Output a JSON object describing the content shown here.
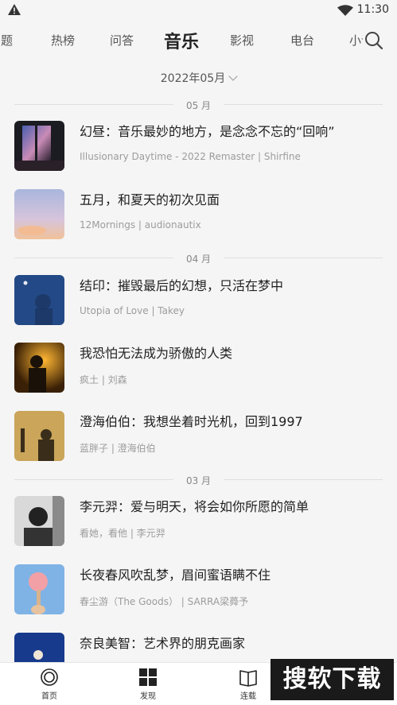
{
  "status_bar": {
    "time": "11:30"
  },
  "tabs": [
    {
      "label": "专题"
    },
    {
      "label": "热榜"
    },
    {
      "label": "问答"
    },
    {
      "label": "音乐"
    },
    {
      "label": "影视"
    },
    {
      "label": "电台"
    },
    {
      "label": "小说"
    }
  ],
  "month_filter": {
    "label": "2022年05月"
  },
  "sections": [
    {
      "month": "05 月",
      "items": [
        {
          "title": "幻昼：音乐最妙的地方，是念念不忘的“回响”",
          "subtitle": "Illusionary Daytime - 2022 Remaster | Shirfine"
        },
        {
          "title": "五月，和夏天的初次见面",
          "subtitle": "12Mornings | audionautix"
        }
      ]
    },
    {
      "month": "04 月",
      "items": [
        {
          "title": "结印：摧毁最后的幻想，只活在梦中",
          "subtitle": "Utopia of Love | Takey"
        },
        {
          "title": "我恐怕无法成为骄傲的人类",
          "subtitle": "疯土 | 刘森"
        },
        {
          "title": "澄海伯伯：我想坐着时光机，回到1997",
          "subtitle": "蓝胖子 | 澄海伯伯"
        }
      ]
    },
    {
      "month": "03 月",
      "items": [
        {
          "title": "李元羿：爱与明天，将会如你所愿的简单",
          "subtitle": "看她，看他 | 李元羿"
        },
        {
          "title": "长夜春风吹乱梦，眉间蜜语瞒不住",
          "subtitle": "春尘游（The Goods） | SARRA梁蕣予"
        },
        {
          "title": "奈良美智：艺术界的朋克画家",
          "subtitle": ""
        }
      ]
    }
  ],
  "bottom_nav": [
    {
      "label": "首页",
      "icon": "home-circle-icon"
    },
    {
      "label": "发现",
      "icon": "grid-icon"
    },
    {
      "label": "连载",
      "icon": "book-icon"
    }
  ],
  "watermark": {
    "text": "搜软下载"
  },
  "colors": {
    "background": "#f5f5f5",
    "title": "#1f1f1f",
    "subtitle": "#9c9c9c"
  }
}
